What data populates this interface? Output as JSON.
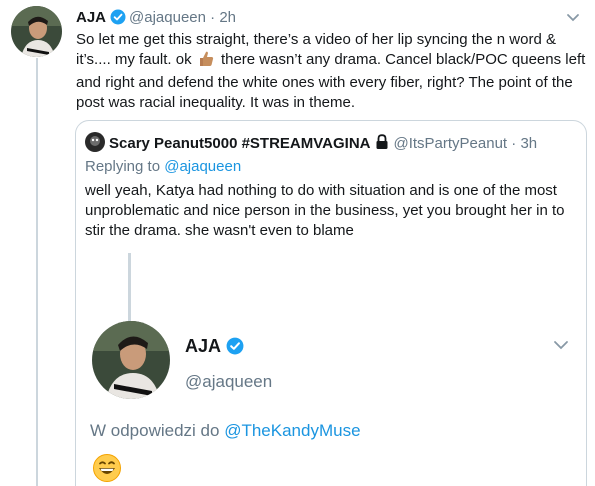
{
  "tweet": {
    "name": "AJA",
    "handle": "@ajaqueen",
    "dot": "·",
    "time": "2h",
    "text_part1": "So let me get this straight, there’s a video of her lip syncing the n word & it’s.... my fault. ok",
    "text_part2": "there wasn’t any drama. Cancel black/POC queens left and right and defend the white ones with every fiber, right? The point of the post was racial inequality. It was in theme."
  },
  "quote": {
    "name": "Scary Peanut5000 #STREAMVAGINA",
    "handle": "@ItsPartyPeanut",
    "dot": "·",
    "time": "3h",
    "replying_prefix": "Replying to",
    "replying_mention": "@ajaqueen",
    "text": "well yeah, Katya had nothing to do with situation and is one of the most unproblematic and nice person in the business, yet you brought her in to stir the drama. she wasn't even to blame"
  },
  "embed": {
    "name": "AJA",
    "handle": "@ajaqueen",
    "reply_prefix": "W odpowiedzi do",
    "reply_mention": "@TheKandyMuse"
  },
  "icons": {
    "verified": "verified-badge-icon",
    "chevron": "chevron-down-icon",
    "lock": "lock-icon",
    "thumbs": "thumbs-up-emoji",
    "grin": "grinning-emoji"
  },
  "colors": {
    "link": "#1b95e0",
    "secondary_text": "#657786",
    "border": "#ccd6dd",
    "verified": "#1da1f2"
  }
}
